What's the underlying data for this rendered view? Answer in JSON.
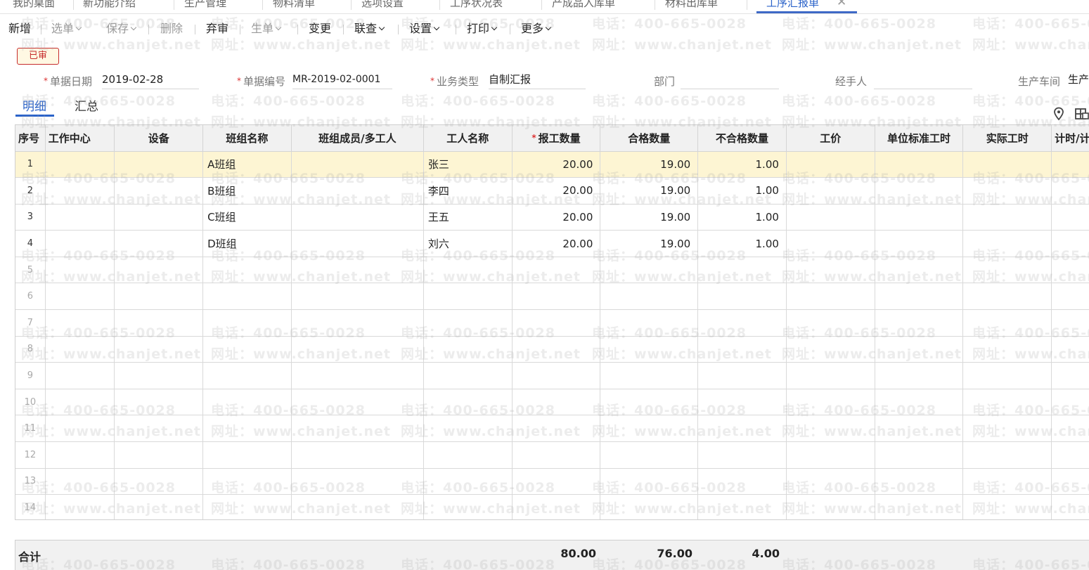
{
  "tabs": [
    {
      "label": "我的桌面"
    },
    {
      "label": "新功能介绍"
    },
    {
      "label": "生产管理"
    },
    {
      "label": "物料清单"
    },
    {
      "label": "选项设置"
    },
    {
      "label": "工序状况表"
    },
    {
      "label": "产成品入库单"
    },
    {
      "label": "材料出库单"
    },
    {
      "label": "工序汇报单",
      "active": true
    }
  ],
  "toolbar": {
    "new": "新增",
    "select": "选单",
    "save": "保存",
    "delete": "删除",
    "unapprove": "弃审",
    "generate": "生单",
    "change": "变更",
    "linked_query": "联查",
    "settings": "设置",
    "print": "打印",
    "more": "更多"
  },
  "status_badge": "已审",
  "form": {
    "doc_date_label": "单据日期",
    "doc_date": "2019-02-28",
    "doc_no_label": "单据编号",
    "doc_no": "MR-2019-02-0001",
    "biz_type_label": "业务类型",
    "biz_type": "自制汇报",
    "dept_label": "部门",
    "dept": "",
    "handler_label": "经手人",
    "handler": "",
    "workshop_label": "生产车间",
    "workshop": "生产"
  },
  "detail_tabs": {
    "detail": "明细",
    "summary": "汇总"
  },
  "icons": {
    "location": "location-pin-icon",
    "grid_settings": "grid-settings-icon"
  },
  "table": {
    "columns": [
      "序号",
      "工作中心",
      "设备",
      "班组名称",
      "班组成员/多工人",
      "工人名称",
      "报工数量",
      "合格数量",
      "不合格数量",
      "工价",
      "单位标准工时",
      "实际工时",
      "计时/计"
    ],
    "rows": [
      {
        "seq": "1",
        "work_center": "",
        "equipment": "",
        "team": "A班组",
        "members": "",
        "worker": "张三",
        "report_qty": "20.00",
        "qualified_qty": "19.00",
        "unqualified_qty": "1.00",
        "price": "",
        "std_hours": "",
        "actual_hours": "",
        "timing": ""
      },
      {
        "seq": "2",
        "work_center": "",
        "equipment": "",
        "team": "B班组",
        "members": "",
        "worker": "李四",
        "report_qty": "20.00",
        "qualified_qty": "19.00",
        "unqualified_qty": "1.00",
        "price": "",
        "std_hours": "",
        "actual_hours": "",
        "timing": ""
      },
      {
        "seq": "3",
        "work_center": "",
        "equipment": "",
        "team": "C班组",
        "members": "",
        "worker": "王五",
        "report_qty": "20.00",
        "qualified_qty": "19.00",
        "unqualified_qty": "1.00",
        "price": "",
        "std_hours": "",
        "actual_hours": "",
        "timing": ""
      },
      {
        "seq": "4",
        "work_center": "",
        "equipment": "",
        "team": "D班组",
        "members": "",
        "worker": "刘六",
        "report_qty": "20.00",
        "qualified_qty": "19.00",
        "unqualified_qty": "1.00",
        "price": "",
        "std_hours": "",
        "actual_hours": "",
        "timing": ""
      }
    ],
    "empty_rows": [
      "5",
      "6",
      "7",
      "8",
      "9",
      "10",
      "11",
      "12",
      "13",
      "14"
    ]
  },
  "totals": {
    "label": "合计",
    "report_qty": "80.00",
    "qualified_qty": "76.00",
    "unqualified_qty": "4.00"
  },
  "watermark": {
    "phone": "电话：400-665-0028",
    "site": "网址：www.chanjet.net"
  },
  "colors": {
    "accent": "#2b63c9",
    "selected_row": "#fdf5d3",
    "badge_red": "#c62c2c"
  }
}
